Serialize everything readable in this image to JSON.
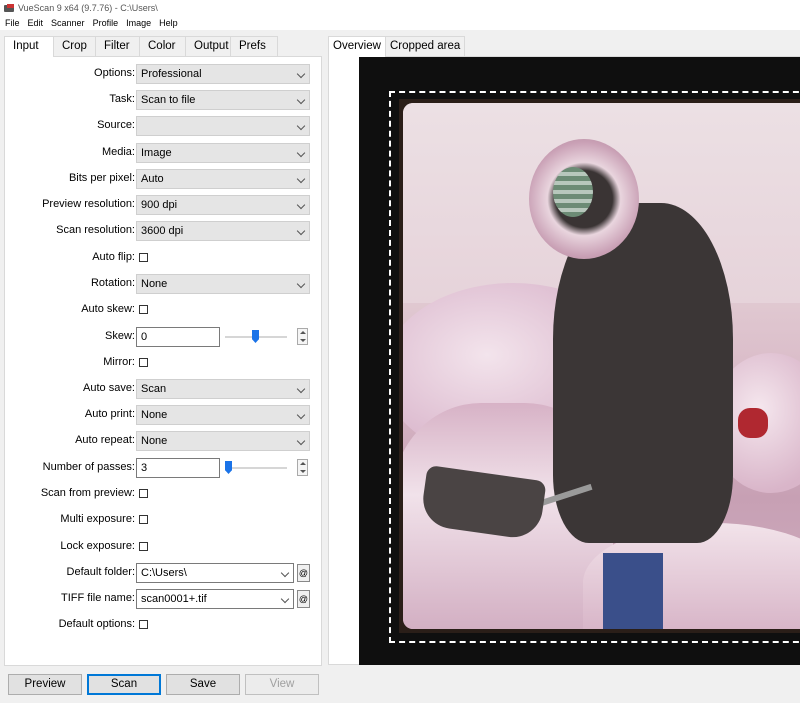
{
  "window": {
    "title": "VueScan 9 x64 (9.7.76) - C:\\Users\\"
  },
  "menu": [
    "File",
    "Edit",
    "Scanner",
    "Profile",
    "Image",
    "Help"
  ],
  "left_tabs": [
    {
      "label": "Input",
      "active": true
    },
    {
      "label": "Crop",
      "active": false
    },
    {
      "label": "Filter",
      "active": false
    },
    {
      "label": "Color",
      "active": false
    },
    {
      "label": "Output",
      "active": false
    },
    {
      "label": "Prefs",
      "active": false
    }
  ],
  "right_tabs": [
    {
      "label": "Overview",
      "active": true
    },
    {
      "label": "Cropped area",
      "active": false
    }
  ],
  "input": {
    "options": {
      "label": "Options:",
      "value": "Professional"
    },
    "task": {
      "label": "Task:",
      "value": "Scan to file"
    },
    "source": {
      "label": "Source:",
      "value": ""
    },
    "media": {
      "label": "Media:",
      "value": "Image"
    },
    "bits_per_pixel": {
      "label": "Bits per pixel:",
      "value": "Auto"
    },
    "preview_resolution": {
      "label": "Preview resolution:",
      "value": "900 dpi"
    },
    "scan_resolution": {
      "label": "Scan resolution:",
      "value": "3600 dpi"
    },
    "auto_flip": {
      "label": "Auto flip:",
      "checked": false
    },
    "rotation": {
      "label": "Rotation:",
      "value": "None"
    },
    "auto_skew": {
      "label": "Auto skew:",
      "checked": false
    },
    "skew": {
      "label": "Skew:",
      "value": "0"
    },
    "mirror": {
      "label": "Mirror:",
      "checked": false
    },
    "auto_save": {
      "label": "Auto save:",
      "value": "Scan"
    },
    "auto_print": {
      "label": "Auto print:",
      "value": "None"
    },
    "auto_repeat": {
      "label": "Auto repeat:",
      "value": "None"
    },
    "number_of_passes": {
      "label": "Number of passes:",
      "value": "3"
    },
    "scan_from_preview": {
      "label": "Scan from preview:",
      "checked": false
    },
    "multi_exposure": {
      "label": "Multi exposure:",
      "checked": false
    },
    "lock_exposure": {
      "label": "Lock exposure:",
      "checked": false
    },
    "default_folder": {
      "label": "Default folder:",
      "value": "C:\\Users\\",
      "button": "@"
    },
    "tiff_file_name": {
      "label": "TIFF file name:",
      "value": "scan0001+.tif",
      "button": "@"
    },
    "default_options": {
      "label": "Default options:",
      "checked": false
    }
  },
  "buttons": {
    "preview": "Preview",
    "scan": "Scan",
    "save": "Save",
    "view": "View"
  },
  "colors": {
    "accent": "#0078d7",
    "slider": "#1a73e8"
  }
}
